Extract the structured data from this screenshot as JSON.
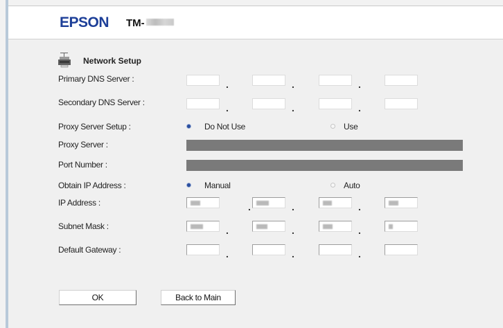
{
  "header": {
    "brand": "EPSON",
    "model_prefix": "TM-"
  },
  "section": {
    "title": "Network Setup",
    "icon": "printer-icon"
  },
  "fields": {
    "primary_dns": {
      "label": "Primary DNS Server :"
    },
    "secondary_dns": {
      "label": "Secondary DNS Server :"
    },
    "proxy_setup": {
      "label": "Proxy Server Setup :",
      "options": [
        "Do Not Use",
        "Use"
      ],
      "selected": "Do Not Use"
    },
    "proxy_server": {
      "label": "Proxy Server :"
    },
    "port_number": {
      "label": "Port Number :"
    },
    "obtain_ip": {
      "label": "Obtain IP Address :",
      "options": [
        "Manual",
        "Auto"
      ],
      "selected": "Manual"
    },
    "ip_address": {
      "label": "IP Address :"
    },
    "subnet_mask": {
      "label": "Subnet Mask :"
    },
    "default_gateway": {
      "label": "Default Gateway :"
    },
    "separator": "."
  },
  "buttons": {
    "ok": "OK",
    "back": "Back to Main"
  },
  "colors": {
    "brand": "#1d3f98",
    "disabled_field": "#7a7a7a",
    "page_background": "#f0f0f0"
  }
}
